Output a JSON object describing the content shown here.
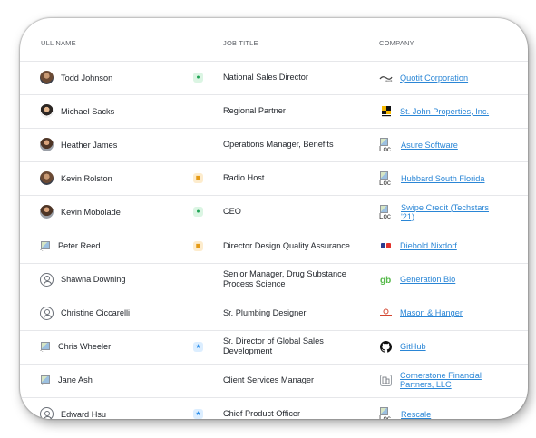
{
  "headers": {
    "name": "ULL NAME",
    "job_title": "JOB TITLE",
    "company": "COMPANY"
  },
  "rows": [
    {
      "name": "Todd Johnson",
      "avatar": "photo",
      "badge": "green",
      "badge_icon": "person-icon",
      "title": "National Sales Director",
      "company": "Quotit Corporation",
      "logo": "quotit-logo"
    },
    {
      "name": "Michael Sacks",
      "avatar": "photo2",
      "badge": "",
      "title": "Regional Partner",
      "company": "St. John Properties, Inc.",
      "logo": "stjohn-logo"
    },
    {
      "name": "Heather James",
      "avatar": "photo3",
      "badge": "",
      "title": "Operations Manager, Benefits",
      "company": "Asure Software",
      "logo": "broken-image",
      "logo_text": "Loc"
    },
    {
      "name": "Kevin Rolston",
      "avatar": "photo",
      "badge": "yellow",
      "badge_icon": "note-icon",
      "title": "Radio Host",
      "company": "Hubbard South Florida",
      "logo": "broken-image",
      "logo_text": "Loc"
    },
    {
      "name": "Kevin Mobolade",
      "avatar": "photo3",
      "badge": "green",
      "badge_icon": "person-icon",
      "title": "CEO",
      "company": "Swipe Credit (Techstars '21)",
      "logo": "broken-image",
      "logo_text": "Loc"
    },
    {
      "name": "Peter Reed",
      "avatar": "broken",
      "badge": "yellow",
      "badge_icon": "note-icon",
      "title": "Director Design Quality Assurance",
      "company": "Diebold Nixdorf",
      "logo": "diebold-logo"
    },
    {
      "name": "Shawna Downing",
      "avatar": "outline",
      "badge": "",
      "title": "Senior Manager, Drug Substance Process Science",
      "company": "Generation Bio",
      "logo": "generationbio-logo"
    },
    {
      "name": "Christine Ciccarelli",
      "avatar": "outline",
      "badge": "",
      "title": "Sr. Plumbing Designer",
      "company": "Mason & Hanger",
      "logo": "masonhanger-logo"
    },
    {
      "name": "Chris Wheeler",
      "avatar": "broken",
      "badge": "blue",
      "badge_icon": "star-icon",
      "title": "Sr. Director of Global Sales Development",
      "company": "GitHub",
      "logo": "github-logo"
    },
    {
      "name": "Jane Ash",
      "avatar": "broken",
      "badge": "",
      "title": "Client Services Manager",
      "company": "Cornerstone Financial Partners, LLC",
      "logo": "building-logo"
    },
    {
      "name": "Edward Hsu",
      "avatar": "outline",
      "badge": "blue",
      "badge_icon": "star-icon",
      "title": "Chief Product Officer",
      "company": "Rescale",
      "logo": "broken-image",
      "logo_text": "Loc"
    }
  ],
  "colors": {
    "link": "#2a86d6",
    "border": "#e6e7ea",
    "card_shadow": "#000000"
  }
}
